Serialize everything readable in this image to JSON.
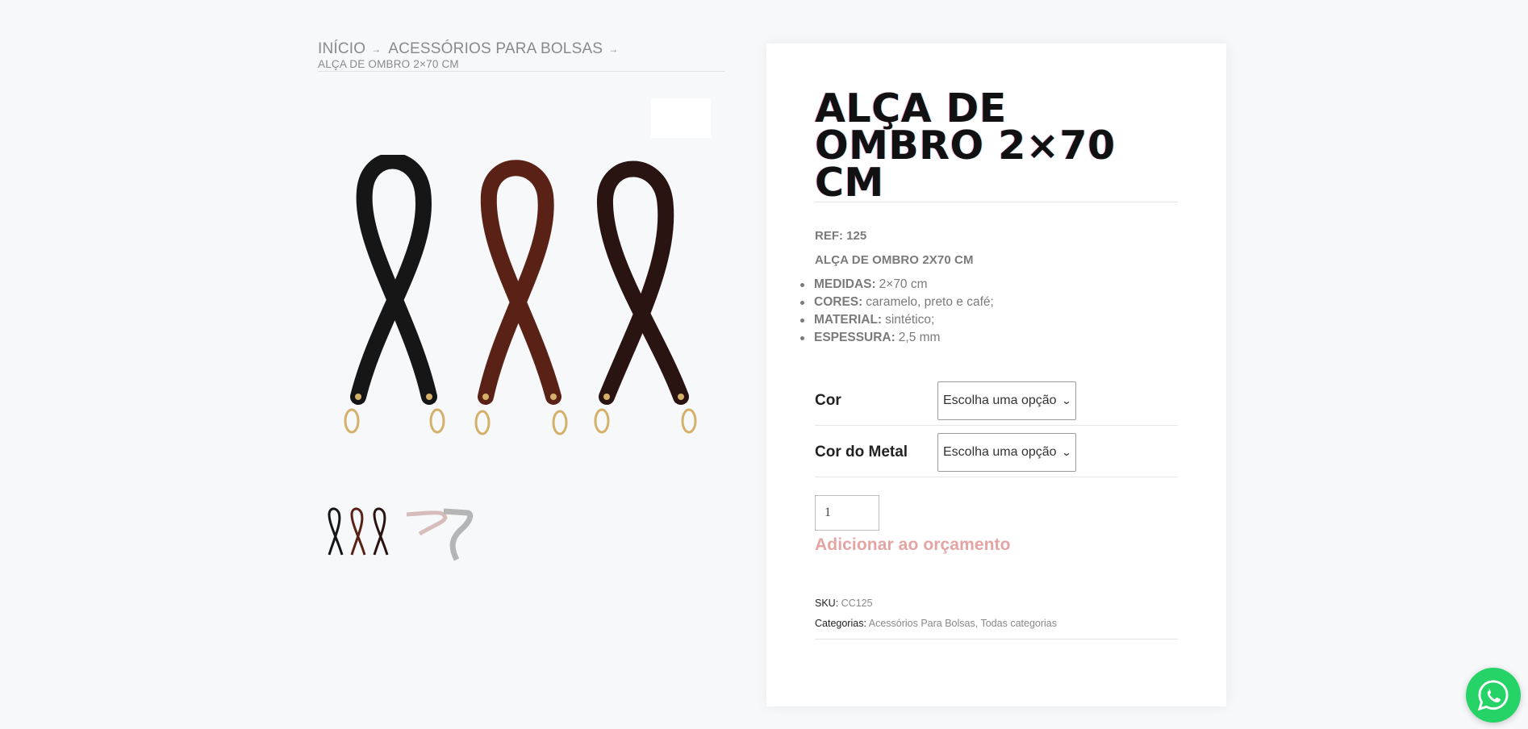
{
  "breadcrumb": {
    "home": "INÍCIO",
    "category": "ACESSÓRIOS PARA BOLSAS",
    "current": "ALÇA DE OMBRO 2×70 CM",
    "separator": "→"
  },
  "product": {
    "title": "ALÇA DE OMBRO 2×70 CM",
    "ref": "REF: 125",
    "subtitle": "ALÇA DE OMBRO 2X70 CM",
    "specs": [
      {
        "label": "MEDIDAS:",
        "value": "2×70 cm"
      },
      {
        "label": "CORES:",
        "value": "caramelo, preto e café;"
      },
      {
        "label": "MATERIAL:",
        "value": "sintético;"
      },
      {
        "label": "ESPESSURA:",
        "value": "2,5 mm"
      }
    ],
    "variations": [
      {
        "label": "Cor",
        "selected": "Escolha uma opção"
      },
      {
        "label": "Cor do Metal",
        "selected": "Escolha uma opção"
      }
    ],
    "quantity": "1",
    "add_button": "Adicionar ao orçamento",
    "sku_label": "SKU:",
    "sku": "CC125",
    "categories_label": "Categorias:",
    "categories": [
      "Acessórios Para Bolsas",
      "Todas categorias"
    ],
    "category_sep": ","
  },
  "gallery": {
    "strap_colors": [
      "#161616",
      "#5a2217",
      "#2a1412"
    ],
    "hardware_color": "#d4b06a",
    "thumb2_colors": [
      "#c9a3a0",
      "#9a9a9a"
    ]
  },
  "colors": {
    "accent": "#e5a4a4",
    "whatsapp": "#25d366"
  },
  "icons": {
    "zoom": "search-zoom-icon",
    "whatsapp": "whatsapp-icon",
    "breadcrumb_sep": "arrow-right-icon",
    "select": "chevron-down-icon"
  }
}
